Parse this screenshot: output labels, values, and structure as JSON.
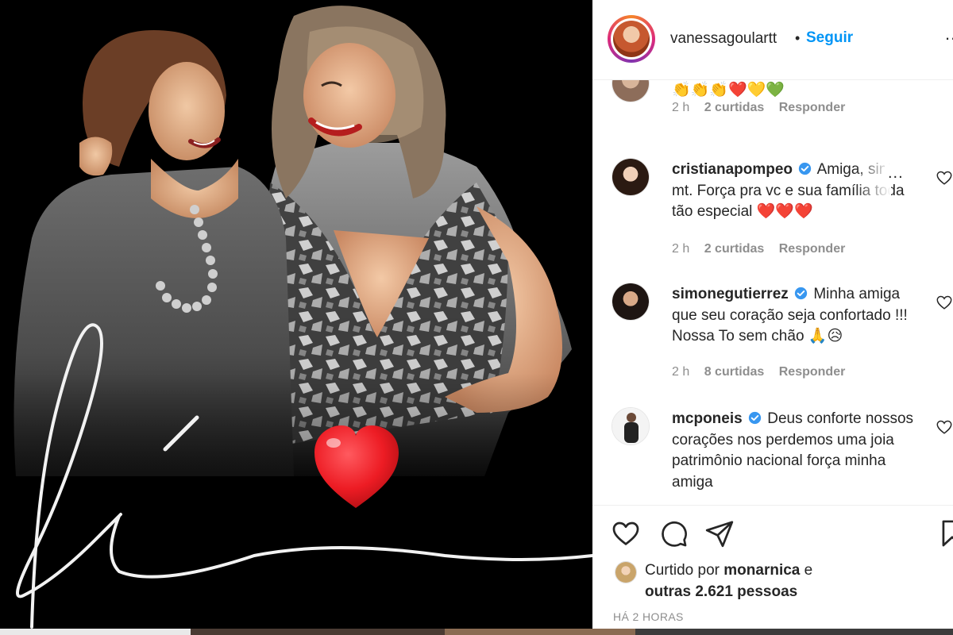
{
  "post": {
    "author": "vanessagoulartt",
    "separator": "•",
    "follow_label": "Seguir",
    "more_label": "...",
    "heart_sticker": "heart-sticker"
  },
  "comments": [
    {
      "username": "",
      "verified": false,
      "text": "👏👏👏❤️💛💚",
      "time": "2 h",
      "likes": "2 curtidas",
      "reply_label": "Responder"
    },
    {
      "username": "cristianapompeo",
      "verified": true,
      "text": "Amiga, sinto mt. Força pra vc e sua família toda tão especial ❤️❤️❤️",
      "time": "2 h",
      "likes": "2 curtidas",
      "reply_label": "Responder",
      "options_label": "..."
    },
    {
      "username": "simonegutierrez",
      "verified": true,
      "text": "Minha amiga que seu coração seja confortado !!! Nossa To sem chão 🙏😥",
      "time": "2 h",
      "likes": "8 curtidas",
      "reply_label": "Responder"
    },
    {
      "username": "mcponeis",
      "verified": true,
      "text": "Deus conforte nossos corações nos perdemos uma joia patrimônio nacional força minha amiga"
    }
  ],
  "liked_by": {
    "prefix": "Curtido por",
    "user": "monarnica",
    "conj": "e",
    "others": "outras 2.621 pessoas"
  },
  "timestamp": "HÁ 2 HORAS",
  "colors": {
    "link_blue": "#0095f6",
    "meta_gray": "#8e8e8e",
    "verified_blue": "#3897f0",
    "heart_red": "#ed1c24"
  },
  "icons": [
    "heart-icon",
    "comment-icon",
    "share-icon",
    "bookmark-icon",
    "verified-badge-icon"
  ]
}
